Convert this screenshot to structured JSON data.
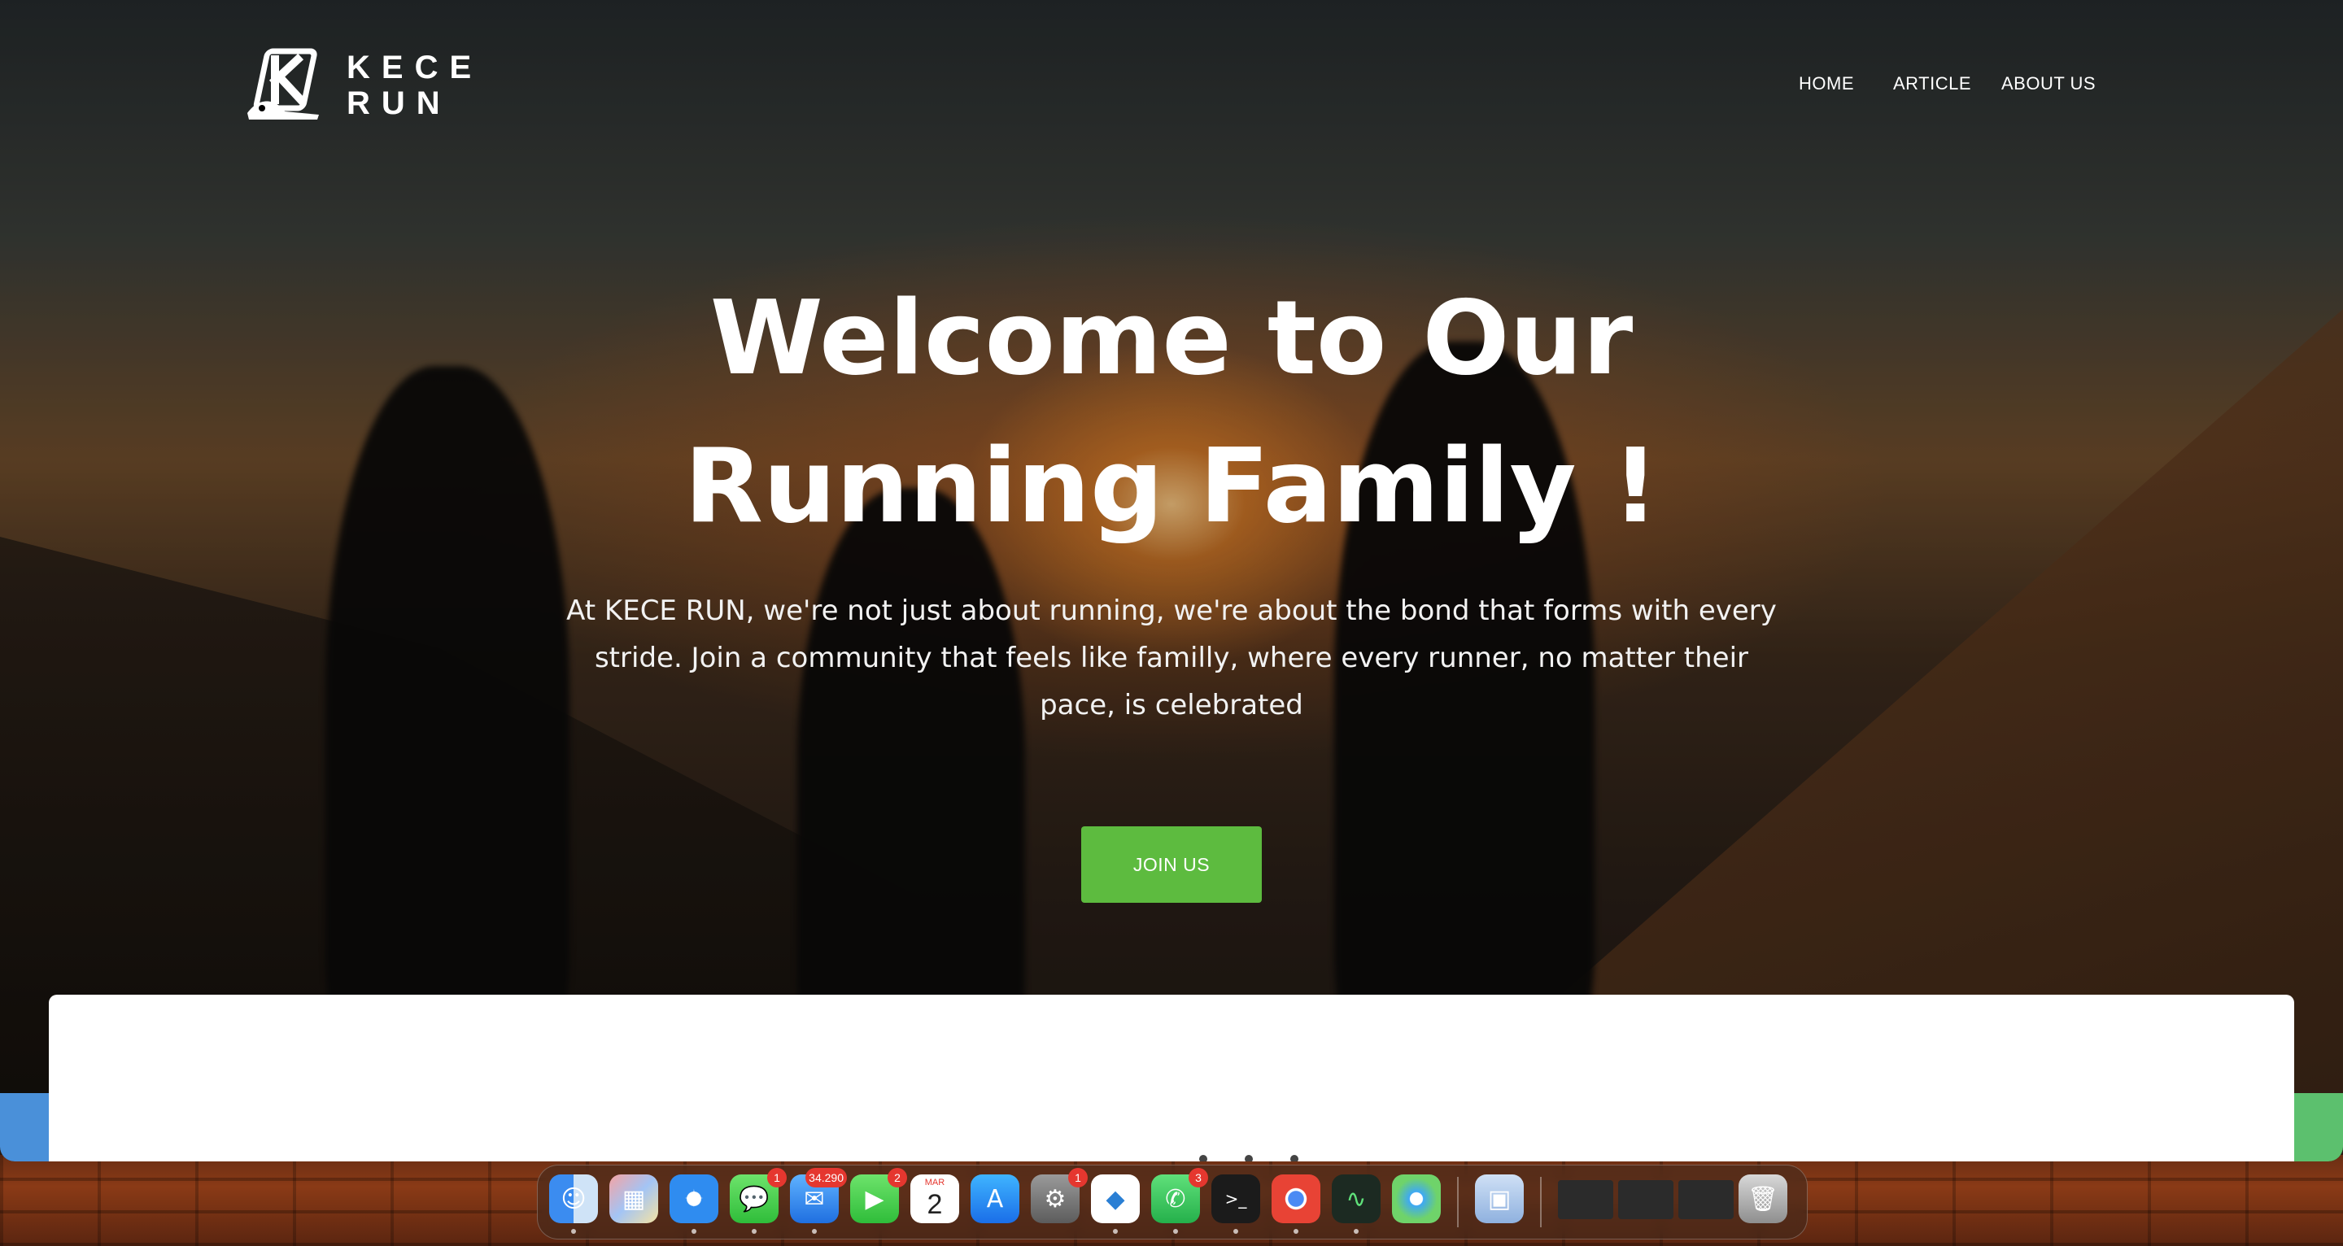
{
  "site": {
    "logo": {
      "line1": "KECE",
      "line2": "RUN"
    },
    "nav": [
      {
        "label": "HOME"
      },
      {
        "label": "ARTICLE"
      },
      {
        "label": "ABOUT US"
      }
    ],
    "hero": {
      "headline_line1": "Welcome to Our",
      "headline_line2": "Running Family !",
      "subtext": "At KECE RUN, we're not just about running, we're about the bond that forms with every stride. Join a community that feels like familly, where every runner, no matter their pace, is celebrated",
      "cta_label": "JOIN US"
    },
    "colors": {
      "cta": "#5dbb3f",
      "text": "#ffffff"
    }
  },
  "dock": {
    "apps": [
      {
        "name": "finder-icon",
        "badge": null
      },
      {
        "name": "launchpad-icon",
        "badge": null
      },
      {
        "name": "safari-icon",
        "badge": null
      },
      {
        "name": "messages-icon",
        "badge": "1"
      },
      {
        "name": "mail-icon",
        "badge": "34.290"
      },
      {
        "name": "facetime-icon",
        "badge": "2"
      },
      {
        "name": "calendar-icon",
        "badge": null,
        "month": "MAR",
        "day": "2"
      },
      {
        "name": "app-store-icon",
        "badge": null
      },
      {
        "name": "system-settings-icon",
        "badge": "1"
      },
      {
        "name": "vscode-icon",
        "badge": null
      },
      {
        "name": "whatsapp-icon",
        "badge": "3"
      },
      {
        "name": "terminal-icon",
        "badge": null
      },
      {
        "name": "chrome-icon",
        "badge": null
      },
      {
        "name": "activity-monitor-icon",
        "badge": null
      },
      {
        "name": "maps-icon",
        "badge": null
      },
      {
        "name": "preview-icon",
        "badge": null
      },
      {
        "name": "window-thumbnail-1",
        "badge": null
      },
      {
        "name": "window-thumbnail-2",
        "badge": null
      },
      {
        "name": "window-thumbnail-3",
        "badge": null
      },
      {
        "name": "trash-icon",
        "badge": null
      }
    ]
  }
}
